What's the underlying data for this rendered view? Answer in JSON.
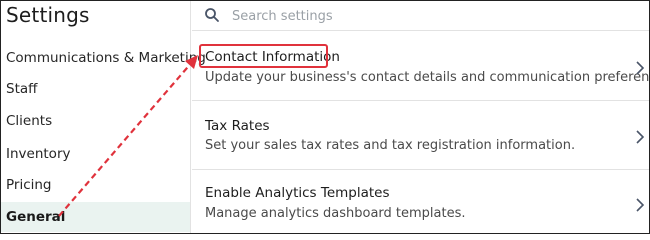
{
  "sidebar": {
    "title": "Settings",
    "items": [
      {
        "label": "Communications & Marketing"
      },
      {
        "label": "Staff"
      },
      {
        "label": "Clients"
      },
      {
        "label": "Inventory"
      },
      {
        "label": "Pricing"
      },
      {
        "label": "General",
        "active": true
      }
    ]
  },
  "search": {
    "placeholder": "Search settings",
    "icon": "search-icon"
  },
  "settings": [
    {
      "title": "Contact Information",
      "description": "Update your business's contact details and communication preferences.",
      "highlighted": true
    },
    {
      "title": "Tax Rates",
      "description": "Set your sales tax rates and tax registration information."
    },
    {
      "title": "Enable Analytics Templates",
      "description": "Manage analytics dashboard templates."
    }
  ],
  "annotation": {
    "color": "#e0323c"
  }
}
